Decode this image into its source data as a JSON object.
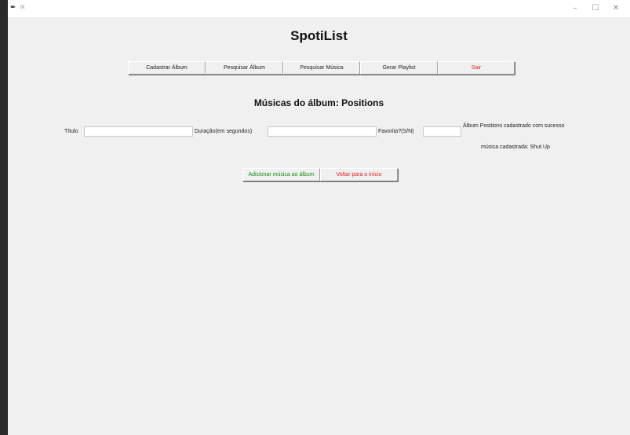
{
  "window": {
    "title": "tk",
    "controls": {
      "minimize": "–",
      "maximize": "☐",
      "close": "✕"
    }
  },
  "app": {
    "title": "SpotiList"
  },
  "menu": [
    {
      "id": "cadastrar-album",
      "label": "Cadastrar Álbum"
    },
    {
      "id": "pesquisar-album",
      "label": "Pesquisar Álbum"
    },
    {
      "id": "pesquisar-musica",
      "label": "Pesquisar Música"
    },
    {
      "id": "gerar-playlist",
      "label": "Gerar Playlist"
    },
    {
      "id": "sair",
      "label": "Sair"
    }
  ],
  "section": {
    "title": "Músicas do álbum: Positions"
  },
  "form": {
    "titulo_label": "Título",
    "titulo_value": "",
    "duracao_label": "Duração(em segundos)",
    "duracao_value": "",
    "favorita_label": "Favorita?(S/N)",
    "favorita_value": ""
  },
  "status": {
    "line1": "Álbum Positions cadastrado com sucesso",
    "line2": "música cadastrada: Shut Up"
  },
  "actions": {
    "add_label": "Adicionar música ao álbum",
    "back_label": "Voltar para o início"
  },
  "colors": {
    "exit_text": "#e02020",
    "add_text": "#1a8a1a",
    "back_text": "#e02020",
    "window_bg": "#f0f0f0"
  }
}
